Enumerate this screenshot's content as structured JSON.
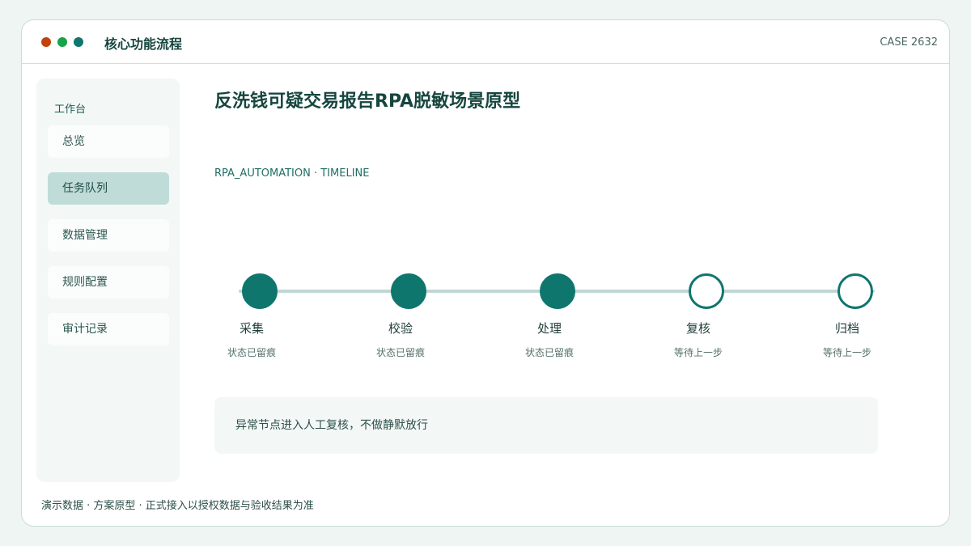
{
  "window": {
    "title": "核心功能流程",
    "case_label": "CASE 2632",
    "dots": [
      "#c2410c",
      "#16a34a",
      "#0f766e"
    ]
  },
  "sidebar": {
    "heading": "工作台",
    "items": [
      {
        "label": "总览",
        "active": false
      },
      {
        "label": "任务队列",
        "active": true
      },
      {
        "label": "数据管理",
        "active": false
      },
      {
        "label": "规则配置",
        "active": false
      },
      {
        "label": "审计记录",
        "active": false
      }
    ]
  },
  "main": {
    "title": "反洗钱可疑交易报告RPA脱敏场景原型",
    "subtitle": "RPA_AUTOMATION · TIMELINE",
    "steps": [
      {
        "label": "采集",
        "status": "状态已留痕",
        "done": true
      },
      {
        "label": "校验",
        "status": "状态已留痕",
        "done": true
      },
      {
        "label": "处理",
        "status": "状态已留痕",
        "done": true
      },
      {
        "label": "复核",
        "status": "等待上一步",
        "done": false
      },
      {
        "label": "归档",
        "status": "等待上一步",
        "done": false
      }
    ],
    "notice": "异常节点进入人工复核，不做静默放行"
  },
  "footer": "演示数据 · 方案原型 · 正式接入以授权数据与验收结果为准",
  "colors": {
    "accent": "#0f766e",
    "track": "#c0d8d4",
    "active_nav": "#c0dcd9"
  }
}
